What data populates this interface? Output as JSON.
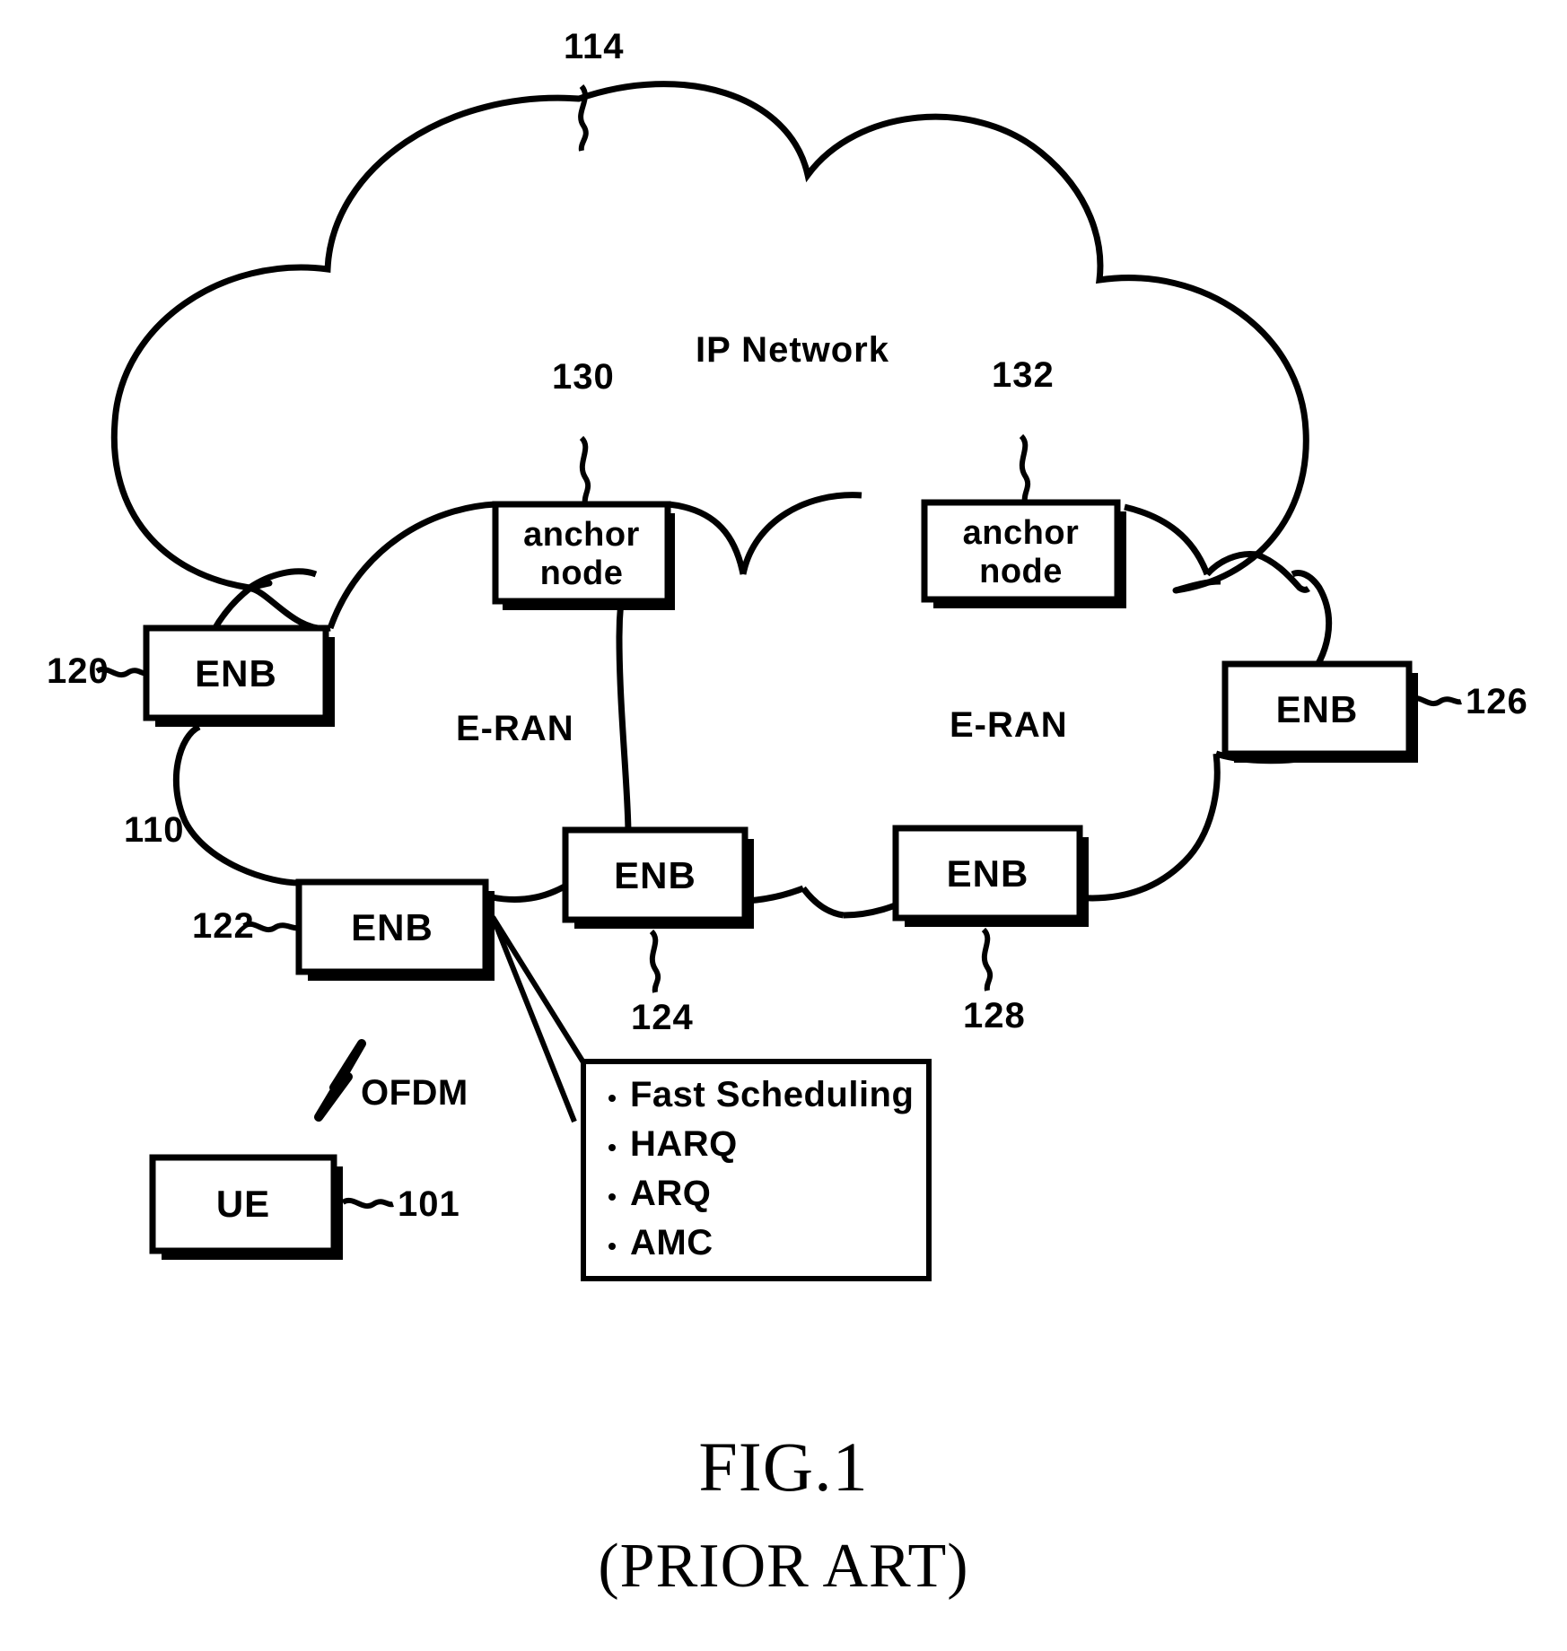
{
  "figure": {
    "caption": "FIG.1",
    "caption_sub": "(PRIOR ART)"
  },
  "clouds": {
    "ip_network": {
      "label": "IP Network",
      "ref": "114"
    },
    "eran_left": {
      "label": "E-RAN",
      "ref": "110"
    },
    "eran_right": {
      "label": "E-RAN",
      "ref": ""
    }
  },
  "nodes": {
    "anchor_left": {
      "line1": "anchor",
      "line2": "node",
      "ref": "130"
    },
    "anchor_right": {
      "line1": "anchor",
      "line2": "node",
      "ref": "132"
    },
    "enb_120": {
      "label": "ENB",
      "ref": "120"
    },
    "enb_122": {
      "label": "ENB",
      "ref": "122"
    },
    "enb_124": {
      "label": "ENB",
      "ref": "124"
    },
    "enb_126": {
      "label": "ENB",
      "ref": "126"
    },
    "enb_128": {
      "label": "ENB",
      "ref": "128"
    },
    "ue": {
      "label": "UE",
      "ref": "101"
    }
  },
  "radio_link": {
    "label": "OFDM",
    "icon": "lightning-bolt-icon"
  },
  "feature_box": {
    "items": [
      "Fast Scheduling",
      "HARQ",
      "ARQ",
      "AMC"
    ]
  },
  "colors": {
    "stroke": "#000000",
    "background": "#ffffff"
  }
}
